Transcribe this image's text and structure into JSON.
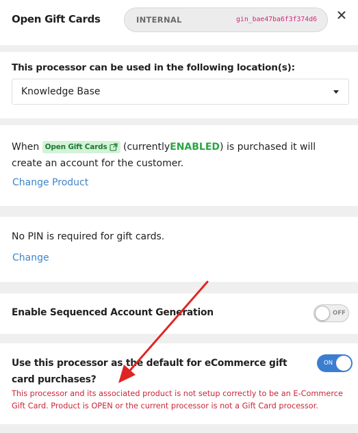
{
  "header": {
    "title": "Open Gift Cards",
    "id_label": "INTERNAL",
    "id_value": "gin_bae47ba6f3f374d6",
    "close_icon": "close-icon"
  },
  "location": {
    "heading": "This processor can be used in the following location(s):",
    "selected": "Knowledge Base"
  },
  "product": {
    "text_before": "When",
    "badge_label": "Open Gift Cards",
    "badge_icon": "external-link-icon",
    "text_middle": "(currently",
    "status": "ENABLED",
    "text_after": ") is purchased it will create an account for the customer.",
    "change_link": "Change Product"
  },
  "pin": {
    "text": "No PIN is required for gift cards.",
    "change_link": "Change"
  },
  "sequenced": {
    "label": "Enable Sequenced Account Generation",
    "toggle_state": "OFF"
  },
  "default_processor": {
    "label": "Use this processor as the default for eCommerce gift card purchases?",
    "toggle_state": "ON",
    "error": "This processor and its associated product is not setup correctly to be an E-Commerce Gift Card. Product is OPEN or the current processor is not a Gift Card processor."
  },
  "colors": {
    "accent": "#3b7dd0",
    "link": "#3d84c8",
    "enabled": "#2aa544",
    "error": "#c9253b",
    "annotation_arrow": "#e02424"
  }
}
